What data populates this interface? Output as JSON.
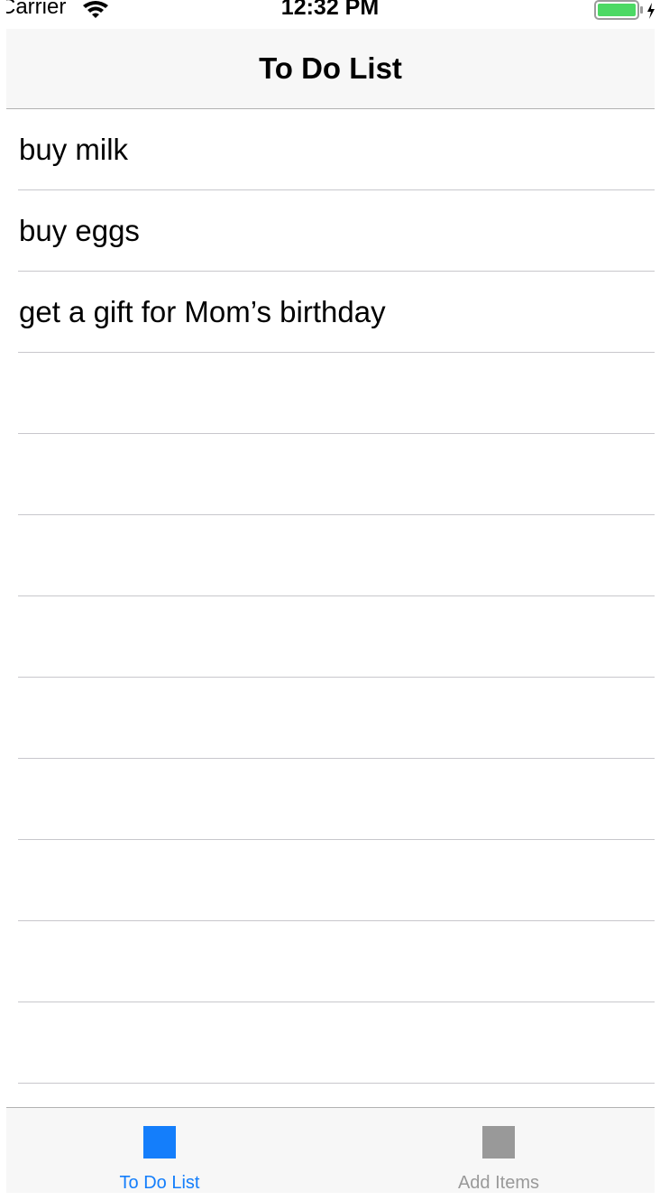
{
  "status_bar": {
    "carrier": "Carrier",
    "time": "12:32 PM",
    "wifi_icon": "wifi-icon",
    "battery_icon": "battery-charging-icon",
    "battery_color": "#4cd964"
  },
  "nav_bar": {
    "title": "To Do List"
  },
  "list": {
    "items": [
      {
        "label": "buy milk"
      },
      {
        "label": "buy eggs"
      },
      {
        "label": "get a gift for Mom’s birthday"
      },
      {
        "label": ""
      },
      {
        "label": ""
      },
      {
        "label": ""
      },
      {
        "label": ""
      },
      {
        "label": ""
      },
      {
        "label": ""
      },
      {
        "label": ""
      },
      {
        "label": ""
      },
      {
        "label": ""
      }
    ]
  },
  "tab_bar": {
    "tabs": [
      {
        "label": "To Do List",
        "icon": "square-icon",
        "selected": true,
        "color": "#147efb"
      },
      {
        "label": "Add Items",
        "icon": "square-icon",
        "selected": false,
        "color": "#999999"
      }
    ]
  }
}
